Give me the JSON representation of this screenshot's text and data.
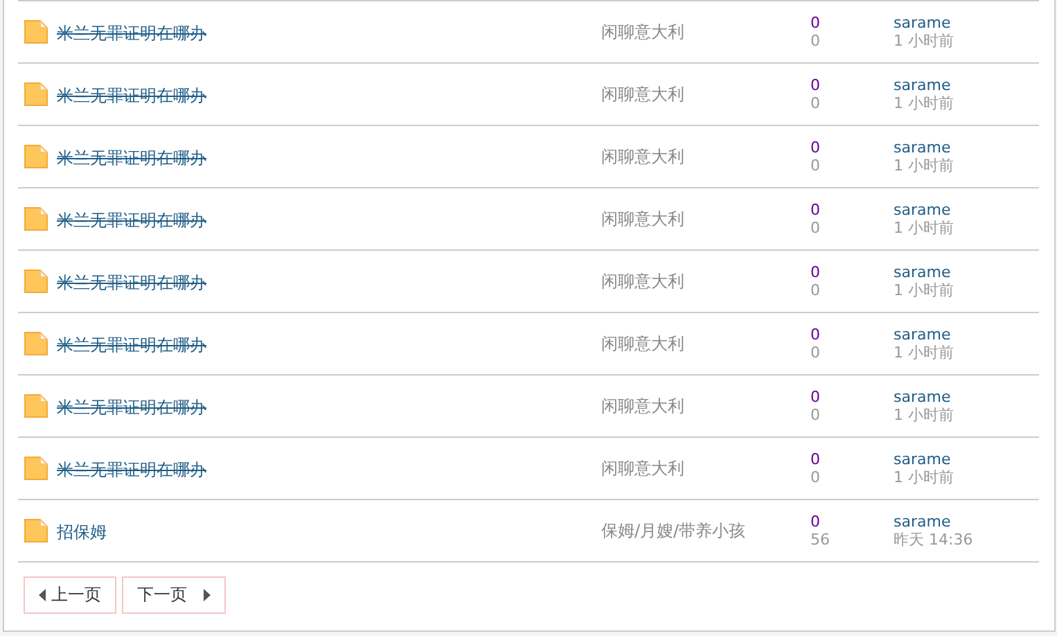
{
  "threads": [
    {
      "title": "米兰无罪证明在哪办",
      "struck": true,
      "forum": "闲聊意大利",
      "replies": "0",
      "views": "0",
      "author": "sarame",
      "time": "1 小时前"
    },
    {
      "title": "米兰无罪证明在哪办",
      "struck": true,
      "forum": "闲聊意大利",
      "replies": "0",
      "views": "0",
      "author": "sarame",
      "time": "1 小时前"
    },
    {
      "title": "米兰无罪证明在哪办",
      "struck": true,
      "forum": "闲聊意大利",
      "replies": "0",
      "views": "0",
      "author": "sarame",
      "time": "1 小时前"
    },
    {
      "title": "米兰无罪证明在哪办",
      "struck": true,
      "forum": "闲聊意大利",
      "replies": "0",
      "views": "0",
      "author": "sarame",
      "time": "1 小时前"
    },
    {
      "title": "米兰无罪证明在哪办",
      "struck": true,
      "forum": "闲聊意大利",
      "replies": "0",
      "views": "0",
      "author": "sarame",
      "time": "1 小时前"
    },
    {
      "title": "米兰无罪证明在哪办",
      "struck": true,
      "forum": "闲聊意大利",
      "replies": "0",
      "views": "0",
      "author": "sarame",
      "time": "1 小时前"
    },
    {
      "title": "米兰无罪证明在哪办",
      "struck": true,
      "forum": "闲聊意大利",
      "replies": "0",
      "views": "0",
      "author": "sarame",
      "time": "1 小时前"
    },
    {
      "title": "米兰无罪证明在哪办",
      "struck": true,
      "forum": "闲聊意大利",
      "replies": "0",
      "views": "0",
      "author": "sarame",
      "time": "1 小时前"
    },
    {
      "title": "招保姆",
      "struck": false,
      "forum": "保姆/月嫂/带养小孩",
      "replies": "0",
      "views": "56",
      "author": "sarame",
      "time": "昨天 14:36"
    }
  ],
  "pager": {
    "prev": "上一页",
    "next": "下一页"
  }
}
